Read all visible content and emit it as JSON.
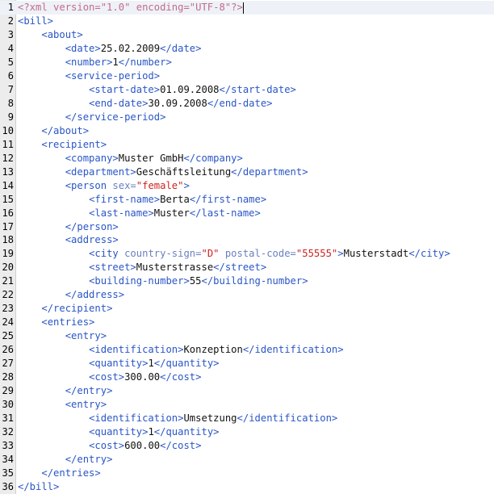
{
  "editor": {
    "indent_unit": "    ",
    "lines": [
      {
        "n": "1",
        "indent": 0,
        "tokens": [
          [
            "pi",
            "<?xml version=\"1.0\" encoding=\"UTF-8\"?>"
          ]
        ]
      },
      {
        "n": "2",
        "indent": 0,
        "tokens": [
          [
            "tag",
            "<bill>"
          ]
        ]
      },
      {
        "n": "3",
        "indent": 1,
        "tokens": [
          [
            "tag",
            "<about>"
          ]
        ]
      },
      {
        "n": "4",
        "indent": 2,
        "tokens": [
          [
            "tag",
            "<date>"
          ],
          [
            "txt",
            "25.02.2009"
          ],
          [
            "tag",
            "</date>"
          ]
        ]
      },
      {
        "n": "5",
        "indent": 2,
        "tokens": [
          [
            "tag",
            "<number>"
          ],
          [
            "txt",
            "1"
          ],
          [
            "tag",
            "</number>"
          ]
        ]
      },
      {
        "n": "6",
        "indent": 2,
        "tokens": [
          [
            "tag",
            "<service-period>"
          ]
        ]
      },
      {
        "n": "7",
        "indent": 3,
        "tokens": [
          [
            "tag",
            "<start-date>"
          ],
          [
            "txt",
            "01.09.2008"
          ],
          [
            "tag",
            "</start-date>"
          ]
        ]
      },
      {
        "n": "8",
        "indent": 3,
        "tokens": [
          [
            "tag",
            "<end-date>"
          ],
          [
            "txt",
            "30.09.2008"
          ],
          [
            "tag",
            "</end-date>"
          ]
        ]
      },
      {
        "n": "9",
        "indent": 2,
        "tokens": [
          [
            "tag",
            "</service-period>"
          ]
        ]
      },
      {
        "n": "10",
        "indent": 1,
        "tokens": [
          [
            "tag",
            "</about>"
          ]
        ]
      },
      {
        "n": "11",
        "indent": 1,
        "tokens": [
          [
            "tag",
            "<recipient>"
          ]
        ]
      },
      {
        "n": "12",
        "indent": 2,
        "tokens": [
          [
            "tag",
            "<company>"
          ],
          [
            "txt",
            "Muster GmbH"
          ],
          [
            "tag",
            "</company>"
          ]
        ]
      },
      {
        "n": "13",
        "indent": 2,
        "tokens": [
          [
            "tag",
            "<department>"
          ],
          [
            "txt",
            "Geschäftsleitung"
          ],
          [
            "tag",
            "</department>"
          ]
        ]
      },
      {
        "n": "14",
        "indent": 2,
        "tokens": [
          [
            "tag",
            "<person "
          ],
          [
            "attr",
            "sex="
          ],
          [
            "val",
            "\"female\""
          ],
          [
            "tag",
            ">"
          ]
        ]
      },
      {
        "n": "15",
        "indent": 3,
        "tokens": [
          [
            "tag",
            "<first-name>"
          ],
          [
            "txt",
            "Berta"
          ],
          [
            "tag",
            "</first-name>"
          ]
        ]
      },
      {
        "n": "16",
        "indent": 3,
        "tokens": [
          [
            "tag",
            "<last-name>"
          ],
          [
            "txt",
            "Muster"
          ],
          [
            "tag",
            "</last-name>"
          ]
        ]
      },
      {
        "n": "17",
        "indent": 2,
        "tokens": [
          [
            "tag",
            "</person>"
          ]
        ]
      },
      {
        "n": "18",
        "indent": 2,
        "tokens": [
          [
            "tag",
            "<address>"
          ]
        ]
      },
      {
        "n": "19",
        "indent": 3,
        "tokens": [
          [
            "tag",
            "<city "
          ],
          [
            "attr",
            "country-sign="
          ],
          [
            "val",
            "\"D\""
          ],
          [
            "attr",
            " postal-code="
          ],
          [
            "val",
            "\"55555\""
          ],
          [
            "tag",
            ">"
          ],
          [
            "txt",
            "Musterstadt"
          ],
          [
            "tag",
            "</city>"
          ]
        ]
      },
      {
        "n": "20",
        "indent": 3,
        "tokens": [
          [
            "tag",
            "<street>"
          ],
          [
            "txt",
            "Musterstrasse"
          ],
          [
            "tag",
            "</street>"
          ]
        ]
      },
      {
        "n": "21",
        "indent": 3,
        "tokens": [
          [
            "tag",
            "<building-number>"
          ],
          [
            "txt",
            "55"
          ],
          [
            "tag",
            "</building-number>"
          ]
        ]
      },
      {
        "n": "22",
        "indent": 2,
        "tokens": [
          [
            "tag",
            "</address>"
          ]
        ]
      },
      {
        "n": "23",
        "indent": 1,
        "tokens": [
          [
            "tag",
            "</recipient>"
          ]
        ]
      },
      {
        "n": "24",
        "indent": 1,
        "tokens": [
          [
            "tag",
            "<entries>"
          ]
        ]
      },
      {
        "n": "25",
        "indent": 2,
        "tokens": [
          [
            "tag",
            "<entry>"
          ]
        ]
      },
      {
        "n": "26",
        "indent": 3,
        "tokens": [
          [
            "tag",
            "<identification>"
          ],
          [
            "txt",
            "Konzeption"
          ],
          [
            "tag",
            "</identification>"
          ]
        ]
      },
      {
        "n": "27",
        "indent": 3,
        "tokens": [
          [
            "tag",
            "<quantity>"
          ],
          [
            "txt",
            "1"
          ],
          [
            "tag",
            "</quantity>"
          ]
        ]
      },
      {
        "n": "28",
        "indent": 3,
        "tokens": [
          [
            "tag",
            "<cost>"
          ],
          [
            "txt",
            "300.00"
          ],
          [
            "tag",
            "</cost>"
          ]
        ]
      },
      {
        "n": "29",
        "indent": 2,
        "tokens": [
          [
            "tag",
            "</entry>"
          ]
        ]
      },
      {
        "n": "30",
        "indent": 2,
        "tokens": [
          [
            "tag",
            "<entry>"
          ]
        ]
      },
      {
        "n": "31",
        "indent": 3,
        "tokens": [
          [
            "tag",
            "<identification>"
          ],
          [
            "txt",
            "Umsetzung"
          ],
          [
            "tag",
            "</identification>"
          ]
        ]
      },
      {
        "n": "32",
        "indent": 3,
        "tokens": [
          [
            "tag",
            "<quantity>"
          ],
          [
            "txt",
            "1"
          ],
          [
            "tag",
            "</quantity>"
          ]
        ]
      },
      {
        "n": "33",
        "indent": 3,
        "tokens": [
          [
            "tag",
            "<cost>"
          ],
          [
            "txt",
            "600.00"
          ],
          [
            "tag",
            "</cost>"
          ]
        ]
      },
      {
        "n": "34",
        "indent": 2,
        "tokens": [
          [
            "tag",
            "</entry>"
          ]
        ]
      },
      {
        "n": "35",
        "indent": 1,
        "tokens": [
          [
            "tag",
            "</entries>"
          ]
        ]
      },
      {
        "n": "36",
        "indent": 0,
        "tokens": [
          [
            "tag",
            "</bill>"
          ]
        ]
      }
    ]
  },
  "colors": {
    "tag": "#2a56c6",
    "attribute": "#6b7fc0",
    "attribute_value": "#cc2222",
    "processing_instruction": "#c46a8a",
    "text": "#111111",
    "gutter": "#ececec",
    "current_line": "#eef2f8"
  }
}
